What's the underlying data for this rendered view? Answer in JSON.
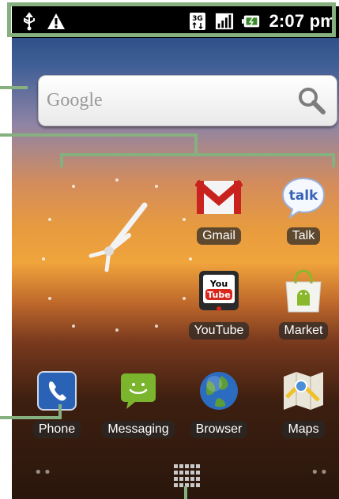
{
  "status_bar": {
    "time": "2:07 pm",
    "network_type": "3G",
    "icons": [
      "usb-icon",
      "warning-icon",
      "3g-icon",
      "signal-icon",
      "battery-icon"
    ]
  },
  "search": {
    "placeholder": "Google"
  },
  "apps": [
    {
      "name": "gmail",
      "label": "Gmail"
    },
    {
      "name": "talk",
      "label": "Talk"
    },
    {
      "name": "youtube",
      "label": "YouTube"
    },
    {
      "name": "market",
      "label": "Market"
    },
    {
      "name": "phone",
      "label": "Phone"
    },
    {
      "name": "messaging",
      "label": "Messaging"
    },
    {
      "name": "browser",
      "label": "Browser"
    },
    {
      "name": "maps",
      "label": "Maps"
    }
  ],
  "colors": {
    "callout": "#86b07f",
    "statusbar": "#000000",
    "label_bg": "rgba(40,40,40,0.72)"
  }
}
